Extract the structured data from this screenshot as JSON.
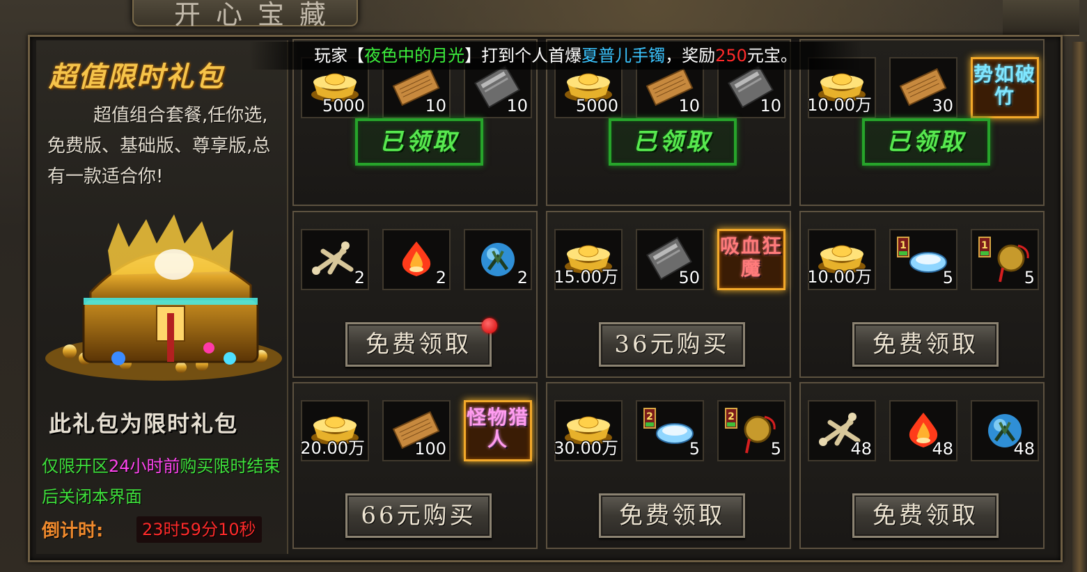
{
  "window": {
    "title": "开心宝藏"
  },
  "announcement": {
    "prefix": "玩家【",
    "player": "夜色中的月光",
    "mid": "】打到个人首爆",
    "item": "夏普儿手镯",
    "mid2": "，奖励",
    "amount": "250",
    "suffix": "元宝。"
  },
  "left_panel": {
    "title": "超值限时礼包",
    "description": "超值组合套餐,任你选,免费版、基础版、尊享版,总有一款适合你!",
    "limited_title": "此礼包为限时礼包",
    "note_prefix": "仅限开区",
    "note_highlight": "24小时前",
    "note_suffix": "购买限时结束后关闭本界面",
    "countdown_label": "倒计时:",
    "countdown_value": "23时59分10秒"
  },
  "packages": [
    {
      "items": [
        {
          "icon": "gold-ingot-icon",
          "count": "5000"
        },
        {
          "icon": "scroll-icon",
          "count": "10"
        },
        {
          "icon": "book-icon",
          "count": "10"
        }
      ],
      "claimed": true,
      "status_label": "已领取"
    },
    {
      "items": [
        {
          "icon": "gold-ingot-icon",
          "count": "5000"
        },
        {
          "icon": "scroll-icon",
          "count": "10"
        },
        {
          "icon": "book-icon",
          "count": "10"
        }
      ],
      "claimed": true,
      "status_label": "已领取"
    },
    {
      "items": [
        {
          "icon": "gold-ingot-icon",
          "count": "10.00万"
        },
        {
          "icon": "scroll-icon",
          "count": "30"
        },
        {
          "icon": "title-badge-icon",
          "badge": "势如破竹",
          "badge_color": "#7fe6ff"
        }
      ],
      "claimed": true,
      "status_label": "已领取"
    },
    {
      "items": [
        {
          "icon": "bones-icon",
          "count": "2"
        },
        {
          "icon": "flame-orb-icon",
          "count": "2"
        },
        {
          "icon": "blue-orb-icon",
          "count": "2"
        }
      ],
      "claimed": false,
      "button_label": "免费领取",
      "has_notification": true
    },
    {
      "items": [
        {
          "icon": "gold-ingot-icon",
          "count": "15.00万"
        },
        {
          "icon": "book-icon",
          "count": "50"
        },
        {
          "icon": "title-badge-icon",
          "badge": "吸血狂魔",
          "badge_color": "#ff7b7b"
        }
      ],
      "claimed": false,
      "button_label": "36元购买"
    },
    {
      "items": [
        {
          "icon": "gold-ingot-icon",
          "count": "10.00万"
        },
        {
          "icon": "gem-bowl-icon",
          "count": "5",
          "tag": "1"
        },
        {
          "icon": "charm-icon",
          "count": "5",
          "tag": "1"
        }
      ],
      "claimed": false,
      "button_label": "免费领取"
    },
    {
      "items": [
        {
          "icon": "gold-ingot-icon",
          "count": "20.00万"
        },
        {
          "icon": "scroll-icon",
          "count": "100"
        },
        {
          "icon": "title-badge-icon",
          "badge": "怪物猎人",
          "badge_color": "#ff9cf0"
        }
      ],
      "claimed": false,
      "button_label": "66元购买"
    },
    {
      "items": [
        {
          "icon": "gold-ingot-icon",
          "count": "30.00万"
        },
        {
          "icon": "gem-bowl-icon",
          "count": "5",
          "tag": "2"
        },
        {
          "icon": "charm-icon",
          "count": "5",
          "tag": "2"
        }
      ],
      "claimed": false,
      "button_label": "免费领取"
    },
    {
      "items": [
        {
          "icon": "bones-icon",
          "count": "48"
        },
        {
          "icon": "flame-orb-icon",
          "count": "48"
        },
        {
          "icon": "blue-orb-icon",
          "count": "48"
        }
      ],
      "claimed": false,
      "button_label": "免费领取"
    }
  ]
}
